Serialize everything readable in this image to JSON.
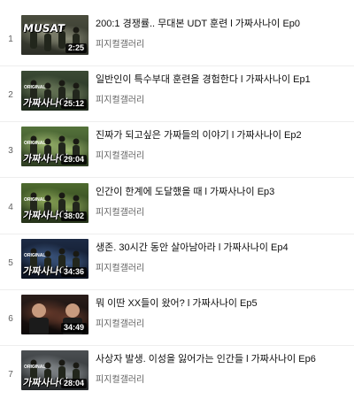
{
  "playlist": {
    "items": [
      {
        "index": "1",
        "title": "200:1 경쟁률.. 무대본 UDT 훈련 l 가짜사나이 Ep0",
        "channel": "피지컬갤러리",
        "duration": "2:25",
        "thumb_text": "MUSAT",
        "thumb_tag": "",
        "palette": [
          "#4a4d3e",
          "#8a8c78",
          "#2d2f27"
        ]
      },
      {
        "index": "2",
        "title": "일반인이 특수부대 훈련을 경험한다 l 가짜사나이 Ep1",
        "channel": "피지컬갤러리",
        "duration": "25:12",
        "thumb_text": "가짜사나이",
        "thumb_tag": "ORIGINAL",
        "palette": [
          "#3b4a35",
          "#6f7d5d",
          "#1f2a1c"
        ]
      },
      {
        "index": "3",
        "title": "진짜가 되고싶은 가짜들의 이야기 l 가짜사나이 Ep2",
        "channel": "피지컬갤러리",
        "duration": "29:04",
        "thumb_text": "가짜사나이",
        "thumb_tag": "ORIGINAL",
        "palette": [
          "#55733b",
          "#9bb56d",
          "#2e3d22"
        ]
      },
      {
        "index": "4",
        "title": "인간이 한계에 도달했을 때 l 가짜사나이 Ep3",
        "channel": "피지컬갤러리",
        "duration": "38:02",
        "thumb_text": "가짜사나이",
        "thumb_tag": "ORIGINAL",
        "palette": [
          "#4d6a2e",
          "#8aa457",
          "#26331a"
        ]
      },
      {
        "index": "5",
        "title": "생존. 30시간 동안 살아남아라 l 가짜사나이 Ep4",
        "channel": "피지컬갤러리",
        "duration": "34:36",
        "thumb_text": "가짜사나이",
        "thumb_tag": "ORIGINAL",
        "palette": [
          "#1d2b45",
          "#3f5b86",
          "#0c1220"
        ]
      },
      {
        "index": "6",
        "title": "뭐 이딴 XX들이 왔어? l 가짜사나이 Ep5",
        "channel": "피지컬갤러리",
        "duration": "34:49",
        "thumb_text": "",
        "thumb_tag": "",
        "palette": [
          "#2a1d1a",
          "#6b3c2c",
          "#0d0908"
        ]
      },
      {
        "index": "7",
        "title": "사상자 발생. 이성을 잃어가는 인간들 l 가짜사나이 Ep6",
        "channel": "피지컬갤러리",
        "duration": "28:04",
        "thumb_text": "가짜사나이",
        "thumb_tag": "ORIGINAL",
        "palette": [
          "#4b4f52",
          "#8c9194",
          "#26292b"
        ]
      }
    ]
  }
}
